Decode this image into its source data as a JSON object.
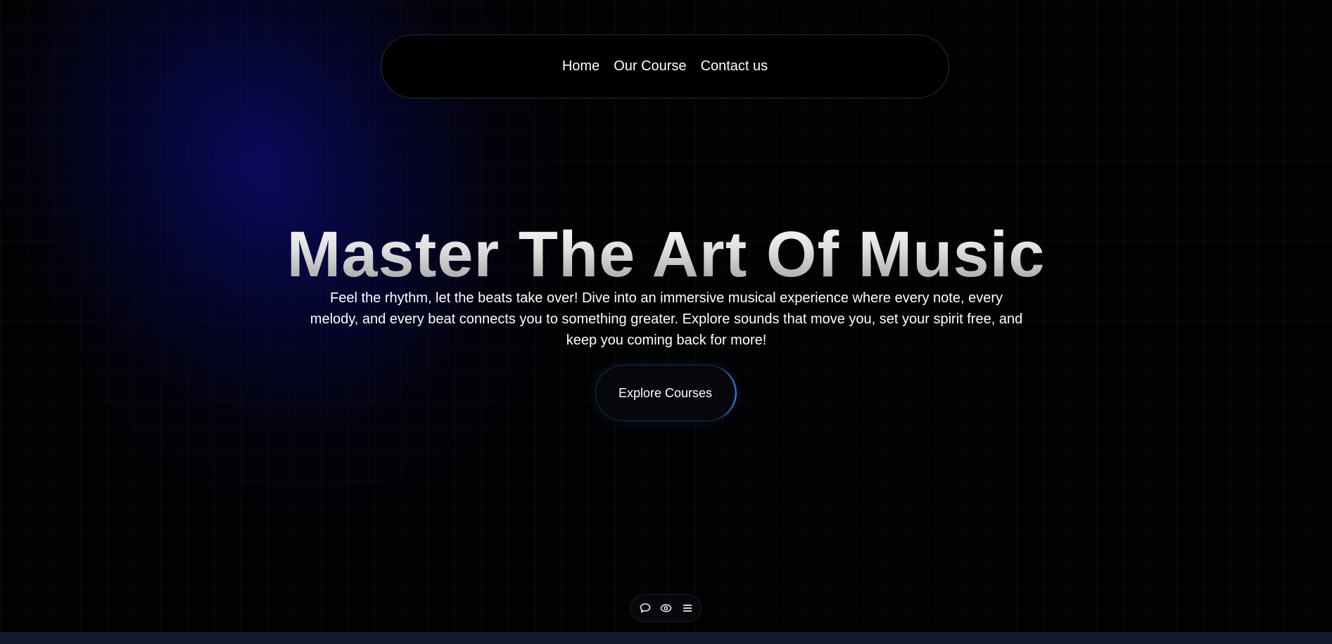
{
  "nav": {
    "links": [
      {
        "label": "Home"
      },
      {
        "label": "Our Course"
      },
      {
        "label": "Contact us"
      }
    ]
  },
  "hero": {
    "title": "Master The Art Of Music",
    "description": "Feel the rhythm, let the beats take over! Dive into an immersive musical experience where every note, every melody, and every beat connects you to something greater. Explore sounds that move you, set your spirit free, and keep you coming back for more!",
    "cta_label": "Explore Courses"
  },
  "toolbar": {
    "icons": [
      "chat-bubble-icon",
      "eye-icon",
      "menu-icon"
    ]
  },
  "colors": {
    "background": "#000000",
    "glow": "#0c0c78",
    "text": "#ffffff",
    "accent": "#2a7fd6",
    "bottom_strip": "#111a2a"
  }
}
